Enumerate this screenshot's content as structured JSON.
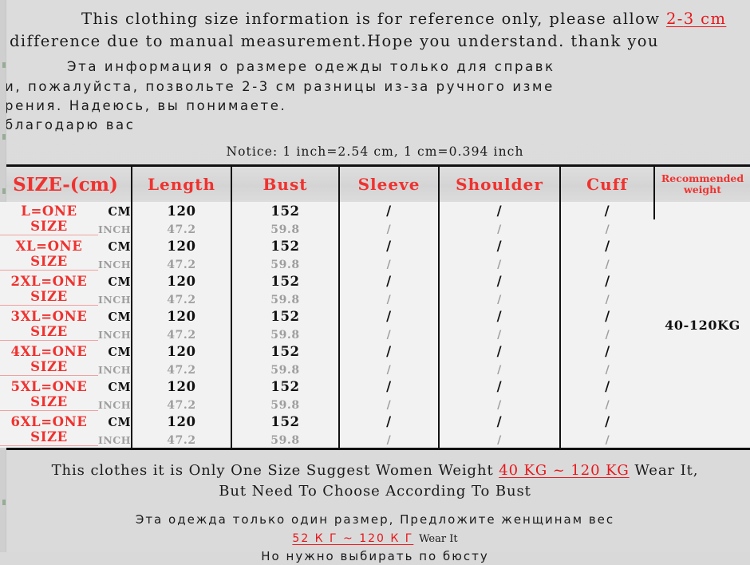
{
  "intro_en": {
    "part1": "This clothing size information is for reference only, please allow ",
    "highlight1": "2-",
    "highlight2": "3 cm",
    "part2": " difference due to manual measurement.Hope you understand. thank you"
  },
  "intro_ru": {
    "line1": "Эта информация о размере одежды только для справк",
    "line2": "и, пожалуйста, позвольте 2-3 см разницы из-за ручного изме",
    "line3": "рения. Надеюсь, вы понимаете.",
    "line4": "благодарю вас"
  },
  "notice": "Notice: 1 inch=2.54 cm, 1 cm=0.394 inch",
  "table": {
    "headers": [
      "SIZE-(cm)",
      "Length",
      "Bust",
      "Sleeve",
      "Shoulder",
      "Cuff"
    ],
    "recommended_weight_header_line1": "Recommended",
    "recommended_weight_header_line2": "weight",
    "unit_cm": "CM",
    "unit_inch": "INCH",
    "recommended_weight_value": "40-120KG",
    "rows": [
      {
        "size": "L=ONE SIZE",
        "cm": {
          "length": "120",
          "bust": "152",
          "sleeve": "/",
          "shoulder": "/",
          "cuff": "/"
        },
        "inch": {
          "length": "47.2",
          "bust": "59.8",
          "sleeve": "/",
          "shoulder": "/",
          "cuff": "/"
        }
      },
      {
        "size": "XL=ONE SIZE",
        "cm": {
          "length": "120",
          "bust": "152",
          "sleeve": "/",
          "shoulder": "/",
          "cuff": "/"
        },
        "inch": {
          "length": "47.2",
          "bust": "59.8",
          "sleeve": "/",
          "shoulder": "/",
          "cuff": "/"
        }
      },
      {
        "size": "2XL=ONE SIZE",
        "cm": {
          "length": "120",
          "bust": "152",
          "sleeve": "/",
          "shoulder": "/",
          "cuff": "/"
        },
        "inch": {
          "length": "47.2",
          "bust": "59.8",
          "sleeve": "/",
          "shoulder": "/",
          "cuff": "/"
        }
      },
      {
        "size": "3XL=ONE SIZE",
        "cm": {
          "length": "120",
          "bust": "152",
          "sleeve": "/",
          "shoulder": "/",
          "cuff": "/"
        },
        "inch": {
          "length": "47.2",
          "bust": "59.8",
          "sleeve": "/",
          "shoulder": "/",
          "cuff": "/"
        }
      },
      {
        "size": "4XL=ONE SIZE",
        "cm": {
          "length": "120",
          "bust": "152",
          "sleeve": "/",
          "shoulder": "/",
          "cuff": "/"
        },
        "inch": {
          "length": "47.2",
          "bust": "59.8",
          "sleeve": "/",
          "shoulder": "/",
          "cuff": "/"
        }
      },
      {
        "size": "5XL=ONE SIZE",
        "cm": {
          "length": "120",
          "bust": "152",
          "sleeve": "/",
          "shoulder": "/",
          "cuff": "/"
        },
        "inch": {
          "length": "47.2",
          "bust": "59.8",
          "sleeve": "/",
          "shoulder": "/",
          "cuff": "/"
        }
      },
      {
        "size": "6XL=ONE SIZE",
        "cm": {
          "length": "120",
          "bust": "152",
          "sleeve": "/",
          "shoulder": "/",
          "cuff": "/"
        },
        "inch": {
          "length": "47.2",
          "bust": "59.8",
          "sleeve": "/",
          "shoulder": "/",
          "cuff": "/"
        }
      }
    ]
  },
  "footer_en": {
    "line1_part1": "This clothes it is Only One Size Suggest Women Weight ",
    "line1_highlight": "40 KG ~ 120 KG",
    "line1_part2": " Wear It,",
    "line2": "But Need To Choose According To Bust"
  },
  "footer_ru": {
    "line1": "Эта одежда только один размер, Предложите женщинам вес",
    "line2_highlight": "52 К Г ~ 120 К Г",
    "line2_suffix": "Wear It",
    "line3": "Но нужно выбирать по бюсту"
  },
  "colors": {
    "accent_red": "#f0322f",
    "text_dark": "#1a1a1a",
    "muted_gray": "#9e9e9e",
    "page_bg": "#dcdcdc",
    "table_bg": "#f2f2f2"
  }
}
